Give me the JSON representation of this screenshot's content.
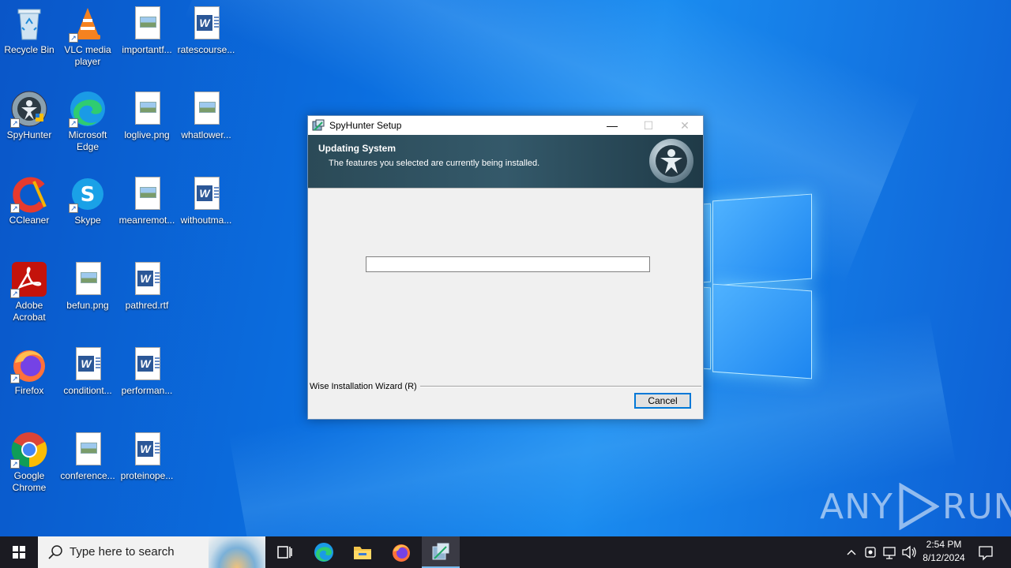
{
  "desktop": {
    "icons": [
      {
        "label": "Recycle Bin"
      },
      {
        "label": "VLC media player"
      },
      {
        "label": "importantf..."
      },
      {
        "label": "ratescourse..."
      },
      {
        "label": "SpyHunter"
      },
      {
        "label": "Microsoft Edge"
      },
      {
        "label": "loglive.png"
      },
      {
        "label": "whatlower..."
      },
      {
        "label": "CCleaner"
      },
      {
        "label": "Skype"
      },
      {
        "label": "meanremot..."
      },
      {
        "label": "withoutma..."
      },
      {
        "label": "Adobe Acrobat"
      },
      {
        "label": "befun.png"
      },
      {
        "label": "pathred.rtf"
      },
      {
        "label": "Firefox"
      },
      {
        "label": "conditiont..."
      },
      {
        "label": "performan..."
      },
      {
        "label": "Google Chrome"
      },
      {
        "label": "conference..."
      },
      {
        "label": "proteinope..."
      }
    ]
  },
  "window": {
    "title": "SpyHunter Setup",
    "header_title": "Updating System",
    "header_subtitle": "The features you selected are currently being installed.",
    "progress": 0,
    "wizard_label": "Wise Installation Wizard (R)",
    "cancel_label": "Cancel"
  },
  "watermark": {
    "left": "ANY",
    "right": "RUN"
  },
  "taskbar": {
    "search_placeholder": "Type here to search",
    "time": "2:54 PM",
    "date": "8/12/2024"
  }
}
